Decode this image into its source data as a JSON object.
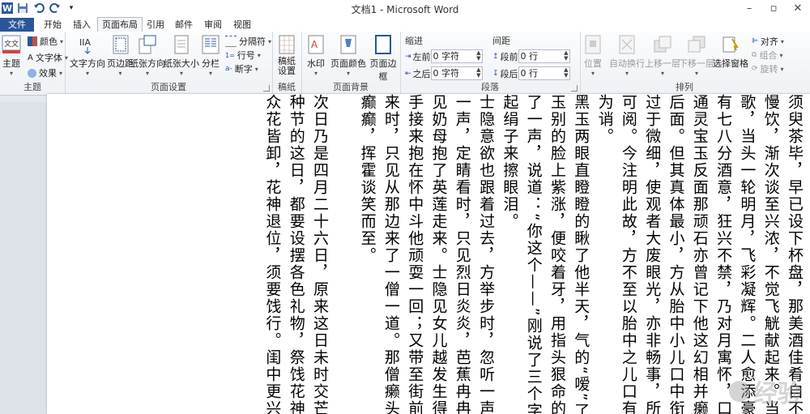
{
  "window": {
    "title": "文档1 - Microsoft Word",
    "controls": [
      "minimize-icon",
      "maximize-icon",
      "close-icon"
    ]
  },
  "qat": {
    "logo": "W",
    "items": [
      "save-icon",
      "undo-icon",
      "redo-icon",
      "customize-icon"
    ]
  },
  "tabs": [
    "文件",
    "开始",
    "插入",
    "页面布局",
    "引用",
    "邮件",
    "审阅",
    "视图"
  ],
  "active_tab": "页面布局",
  "ribbon": {
    "themes": {
      "label": "主题",
      "theme": "主题",
      "colors": "颜色",
      "fonts": "文字体",
      "effects": "效果"
    },
    "page_setup": {
      "label": "页面设置",
      "text_direction": "文字方向",
      "margins": "页边距",
      "orientation": "纸张方向",
      "size": "纸张大小",
      "columns": "分栏",
      "breaks": "分隔符",
      "line_numbers": "行号",
      "hyphenation": "断字"
    },
    "manuscript": {
      "label": "稿纸",
      "button": "稿纸设置"
    },
    "page_background": {
      "label": "页面背景",
      "watermark": "水印",
      "page_color": "页面颜色",
      "page_borders": "页面边框"
    },
    "paragraph": {
      "label": "段落",
      "indent_title": "缩进",
      "spacing_title": "间距",
      "left_label": "左前",
      "right_label": "之后",
      "left_value": "0 字符",
      "right_value": "0 字符",
      "before_label": "段前",
      "after_label": "段后",
      "before_value": "0 行",
      "after_value": "0 行"
    },
    "arrange": {
      "label": "排列",
      "position": "位置",
      "wrap": "自动换行",
      "forward": "上移一层",
      "backward": "下移一层",
      "selection_pane": "选择窗格",
      "align": "对齐",
      "group": "组合",
      "rotate": "旋转"
    }
  },
  "document": {
    "columns": [
      "须臾茶毕，早已设下杯盘，那美酒佳肴自不必说，二人归坐，",
      "慢饮，渐次谈至兴浓，不觉飞觥献起来。当时街上家家箫管，",
      "歌，当头一轮明月，飞彩凝辉。二人愈添豪兴，酒到杯干。雨",
      "有七八分酒意，狂兴不禁，乃对月寓怀，口占一绝云：",
      "通灵宝玉反面那顽石亦曾记下他这幻相并癞僧所镌篆文，今亦",
      "后面。但其真体最小，方从胎中小儿口中衔下，今若按式画出",
      "过于微细，使观者大废眼光，亦非畅事，所以略展放些，以便",
      "可阅。今注明此故，方不至以胎中之儿口有多大，怎得衔此狼",
      "为诮。",
      "黑玉两眼直瞪瞪的瞅了他半天，气的“嗳”了一声，说不出话",
      "玉别的脸上紫涨，便咬着牙，用指头狠命的在他额上戳了一下",
      "了一声，说道：“你这个——”刚说了三个字，便又叹了一口",
      "起绢子来擦眼泪。",
      "士隐意欲也跟着过去，方举步时，忽听一声霹雳若山崩地陷，",
      "一声，定睛看时，只见烈日炎炎，芭蕉冉冉，梦中之事便忘了",
      "见奶母抱了英莲走来。士隐见女儿越发生得粉装玉琢，乖觉可",
      "手接来抱在怀中斗他顽耍一回；又带至街前，看那过会的热闹",
      "来时，只见从那边来了一僧一道。那僧癞头跣足，那道跛足蓬",
      "癫癫，挥霍谈笑而至。",
      "",
      "次日乃是四月二十六日，原来这日未时交芒种节。尚古风俗",
      "种节的这日，都要设摆各色礼物，祭饯花神，言芒种一过，便是",
      "众花皆卸，花神退位，须要饯行。闺中更兴这件风俗，所以大"
    ]
  },
  "watermark": {
    "text": "经验"
  }
}
